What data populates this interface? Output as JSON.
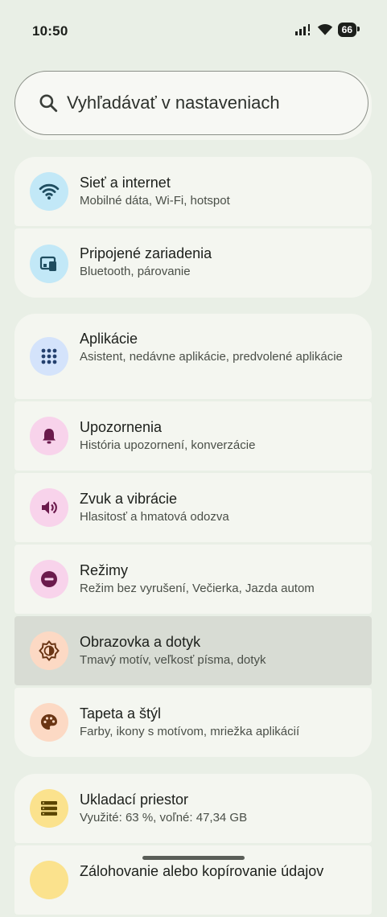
{
  "status": {
    "time": "10:50",
    "battery": "66"
  },
  "search": {
    "placeholder": "Vyhľadávať v nastaveniach"
  },
  "items": [
    {
      "title": "Sieť a internet",
      "subtitle": "Mobilné dáta, Wi-Fi, hotspot",
      "icon": "wifi-icon",
      "bg": "#c2e8f7",
      "fg": "#1f4d60"
    },
    {
      "title": "Pripojené zariadenia",
      "subtitle": "Bluetooth, párovanie",
      "icon": "devices-icon",
      "bg": "#c2e8f7",
      "fg": "#1f4d60"
    },
    {
      "title": "Aplikácie",
      "subtitle": "Asistent, nedávne aplikácie, predvolené aplikácie",
      "icon": "apps-grid-icon",
      "bg": "#d4e3fb",
      "fg": "#24406e"
    },
    {
      "title": "Upozornenia",
      "subtitle": "História upozornení, konverzácie",
      "icon": "bell-icon",
      "bg": "#f8d3eb",
      "fg": "#6b1a4c"
    },
    {
      "title": "Zvuk a vibrácie",
      "subtitle": "Hlasitosť a hmatová odozva",
      "icon": "volume-icon",
      "bg": "#f8d3eb",
      "fg": "#6b1a4c"
    },
    {
      "title": "Režimy",
      "subtitle": "Režim bez vyrušení, Večierka, Jazda autom",
      "icon": "do-not-disturb-icon",
      "bg": "#f8d3eb",
      "fg": "#6b1a4c"
    },
    {
      "title": "Obrazovka a dotyk",
      "subtitle": "Tmavý motív, veľkosť písma, dotyk",
      "icon": "brightness-icon",
      "bg": "#fcd9c4",
      "fg": "#6a3514"
    },
    {
      "title": "Tapeta a štýl",
      "subtitle": "Farby, ikony s motívom, mriežka aplikácií",
      "icon": "palette-icon",
      "bg": "#fcd9c4",
      "fg": "#6a3514"
    },
    {
      "title": "Ukladací priestor",
      "subtitle": "Využité: 63 %, voľné: 47,34 GB",
      "icon": "storage-icon",
      "bg": "#fbe28d",
      "fg": "#5a4500"
    },
    {
      "title": "Zálohovanie alebo kopírovanie údajov",
      "subtitle": "",
      "icon": "backup-icon",
      "bg": "#fbe28d",
      "fg": "#5a4500"
    }
  ]
}
